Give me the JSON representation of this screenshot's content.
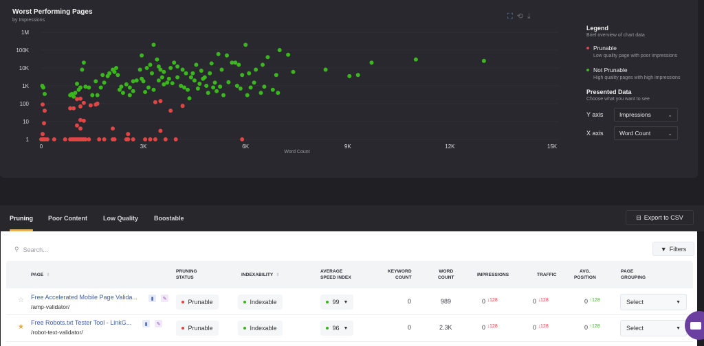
{
  "chart": {
    "title": "Worst Performing Pages",
    "subtitle": "by Impressions",
    "tools": [
      "zoom-select-icon",
      "zoom-reset-icon",
      "download-icon"
    ]
  },
  "legend": {
    "title": "Legend",
    "description": "Brief overview of chart data",
    "items": [
      {
        "label": "Prunable",
        "description": "Low quality page with poor impressions",
        "color": "#e04646"
      },
      {
        "label": "Not Prunable",
        "description": "High quality pages with high impressions",
        "color": "#3cb61e"
      }
    ]
  },
  "presented": {
    "title": "Presented Data",
    "description": "Choose what you want to see",
    "y_label": "Y axis",
    "y_value": "Impressions",
    "x_label": "X axis",
    "x_value": "Word Count"
  },
  "chart_data": {
    "type": "scatter",
    "title": "Worst Performing Pages",
    "subtitle": "by Impressions",
    "xlabel": "Word Count",
    "ylabel": "Impressions",
    "xlim": [
      0,
      15000
    ],
    "ylim": [
      1,
      1000000
    ],
    "yscale": "log",
    "x_ticks": [
      "0",
      "3K",
      "6K",
      "9K",
      "12K",
      "15K"
    ],
    "y_ticks": [
      "1",
      "10",
      "100",
      "1K",
      "10K",
      "100K",
      "1M"
    ],
    "grid": true,
    "legend": "right",
    "series": [
      {
        "name": "Prunable",
        "color": "#e04646",
        "points": [
          [
            0,
            1
          ],
          [
            40,
            1
          ],
          [
            80,
            1
          ],
          [
            120,
            1
          ],
          [
            180,
            1
          ],
          [
            380,
            1
          ],
          [
            700,
            1
          ],
          [
            850,
            1
          ],
          [
            900,
            1
          ],
          [
            950,
            1
          ],
          [
            1000,
            1
          ],
          [
            1050,
            1
          ],
          [
            1100,
            1
          ],
          [
            1150,
            1
          ],
          [
            1200,
            1
          ],
          [
            1250,
            1
          ],
          [
            1300,
            1
          ],
          [
            1400,
            1
          ],
          [
            1700,
            1
          ],
          [
            1850,
            1
          ],
          [
            2100,
            1
          ],
          [
            2150,
            1
          ],
          [
            2500,
            1
          ],
          [
            2550,
            1
          ],
          [
            2700,
            1
          ],
          [
            3050,
            1
          ],
          [
            3200,
            1
          ],
          [
            3350,
            1
          ],
          [
            3650,
            1
          ],
          [
            3950,
            1
          ],
          [
            5900,
            1
          ],
          [
            40,
            2
          ],
          [
            80,
            8
          ],
          [
            40,
            90
          ],
          [
            100,
            40
          ],
          [
            1050,
            6
          ],
          [
            1150,
            4
          ],
          [
            1150,
            12
          ],
          [
            1250,
            11
          ],
          [
            2100,
            4
          ],
          [
            2550,
            2
          ],
          [
            3500,
            3
          ],
          [
            850,
            55
          ],
          [
            950,
            55
          ],
          [
            1150,
            70
          ],
          [
            1250,
            110
          ],
          [
            1050,
            180
          ],
          [
            1150,
            190
          ],
          [
            1450,
            80
          ],
          [
            1600,
            90
          ],
          [
            1650,
            100
          ],
          [
            3350,
            120
          ],
          [
            3500,
            140
          ],
          [
            3800,
            40
          ],
          [
            4150,
            75
          ]
        ]
      },
      {
        "name": "Not Prunable",
        "color": "#3cb61e",
        "points": [
          [
            30,
            1000
          ],
          [
            60,
            800
          ],
          [
            100,
            350
          ],
          [
            850,
            300
          ],
          [
            900,
            350
          ],
          [
            950,
            250
          ],
          [
            1000,
            400
          ],
          [
            1100,
            600
          ],
          [
            1150,
            800
          ],
          [
            1050,
            1300
          ],
          [
            1200,
            8000
          ],
          [
            1250,
            20000
          ],
          [
            1300,
            900
          ],
          [
            1400,
            800
          ],
          [
            1500,
            300
          ],
          [
            1600,
            1800
          ],
          [
            1650,
            300
          ],
          [
            1750,
            800
          ],
          [
            1850,
            1500
          ],
          [
            1800,
            4000
          ],
          [
            1950,
            3500
          ],
          [
            2000,
            5000
          ],
          [
            2100,
            8000
          ],
          [
            2150,
            6000
          ],
          [
            2200,
            10000
          ],
          [
            2250,
            4000
          ],
          [
            2300,
            600
          ],
          [
            2350,
            900
          ],
          [
            2400,
            400
          ],
          [
            2500,
            1200
          ],
          [
            2600,
            300
          ],
          [
            2700,
            500
          ],
          [
            2800,
            2000
          ],
          [
            2900,
            8000
          ],
          [
            2950,
            50000
          ],
          [
            3000,
            1800
          ],
          [
            3100,
            10000
          ],
          [
            3200,
            15000
          ],
          [
            3300,
            200000
          ],
          [
            3250,
            5000
          ],
          [
            3400,
            30000
          ],
          [
            3450,
            12000
          ],
          [
            3500,
            8000
          ],
          [
            3550,
            3000
          ],
          [
            3600,
            6000
          ],
          [
            3700,
            1500
          ],
          [
            3800,
            10000
          ],
          [
            3900,
            20000
          ],
          [
            4000,
            3000
          ],
          [
            4100,
            1000
          ],
          [
            4200,
            800
          ],
          [
            4300,
            600
          ],
          [
            4350,
            200
          ],
          [
            4450,
            5000
          ],
          [
            4550,
            15000
          ],
          [
            4650,
            1300
          ],
          [
            4700,
            7000
          ],
          [
            4800,
            3000
          ],
          [
            4900,
            400
          ],
          [
            5000,
            18000
          ],
          [
            5100,
            1500
          ],
          [
            5200,
            60000
          ],
          [
            5300,
            8000
          ],
          [
            5450,
            50000
          ],
          [
            5600,
            20000
          ],
          [
            5700,
            20000
          ],
          [
            5800,
            15000
          ],
          [
            5900,
            4000
          ],
          [
            6000,
            200000
          ],
          [
            6100,
            5000
          ],
          [
            6300,
            8000
          ],
          [
            6500,
            15000
          ],
          [
            6650,
            40000
          ],
          [
            6900,
            4000
          ],
          [
            7000,
            100000
          ],
          [
            7250,
            55000
          ],
          [
            7400,
            6000
          ],
          [
            8350,
            8000
          ],
          [
            9050,
            3500
          ],
          [
            9300,
            4000
          ],
          [
            9700,
            20000
          ],
          [
            11000,
            30000
          ],
          [
            13000,
            25000
          ],
          [
            2600,
            800
          ],
          [
            2700,
            1800
          ],
          [
            2950,
            2500
          ],
          [
            3050,
            450
          ],
          [
            3150,
            800
          ],
          [
            3300,
            600
          ],
          [
            3450,
            2000
          ],
          [
            3600,
            1200
          ],
          [
            3750,
            2500
          ],
          [
            3850,
            1400
          ],
          [
            4000,
            12000
          ],
          [
            4150,
            8000
          ],
          [
            4250,
            5000
          ],
          [
            4400,
            3000
          ],
          [
            4500,
            2000
          ],
          [
            4600,
            700
          ],
          [
            4750,
            2500
          ],
          [
            4850,
            1000
          ],
          [
            4950,
            5000
          ],
          [
            5050,
            800
          ],
          [
            5150,
            500
          ],
          [
            5250,
            900
          ],
          [
            5350,
            300
          ],
          [
            5500,
            1600
          ],
          [
            5750,
            1000
          ],
          [
            5850,
            700
          ],
          [
            6050,
            300
          ],
          [
            6150,
            800
          ],
          [
            6250,
            1500
          ],
          [
            6450,
            400
          ],
          [
            6550,
            900
          ],
          [
            6800,
            600
          ],
          [
            6950,
            400
          ]
        ]
      }
    ]
  },
  "tabs": [
    "Pruning",
    "Poor Content",
    "Low Quality",
    "Boostable"
  ],
  "active_tab": "Pruning",
  "export_label": "Export to CSV",
  "search_placeholder": "Search...",
  "filters_label": "Filters",
  "table": {
    "headers": {
      "page": "PAGE",
      "pruning_status": [
        "PRUNING",
        "STATUS"
      ],
      "indexability": "INDEXABILITY",
      "avg_speed": [
        "AVERAGE",
        "SPEED INDEX"
      ],
      "keyword_count": [
        "KEYWORD",
        "COUNT"
      ],
      "word_count": [
        "WORD",
        "COUNT"
      ],
      "impressions": "IMPRESSIONS",
      "traffic": "TRAFFIC",
      "avg_position": [
        "AVG.",
        "POSITION"
      ],
      "page_grouping": [
        "PAGE",
        "GROUPING"
      ]
    },
    "rows": [
      {
        "starred": false,
        "title": "Free Accelerated Mobile Page Valida...",
        "url": "/amp-validator/",
        "pruning_status": "Prunable",
        "indexability": "Indexable",
        "speed": "99",
        "keyword_count": "0",
        "word_count": "989",
        "impressions": "0",
        "impressions_delta": "128",
        "traffic": "0",
        "traffic_delta": "128",
        "avg_position": "0",
        "avg_position_delta": "128",
        "grouping": "Select"
      },
      {
        "starred": true,
        "title": "Free Robots.txt Tester Tool - LinkG...",
        "url": "/robot-text-validator/",
        "pruning_status": "Prunable",
        "indexability": "Indexable",
        "speed": "96",
        "keyword_count": "0",
        "word_count": "2.3K",
        "impressions": "0",
        "impressions_delta": "128",
        "traffic": "0",
        "traffic_delta": "128",
        "avg_position": "0",
        "avg_position_delta": "128",
        "grouping": "Select"
      }
    ]
  }
}
